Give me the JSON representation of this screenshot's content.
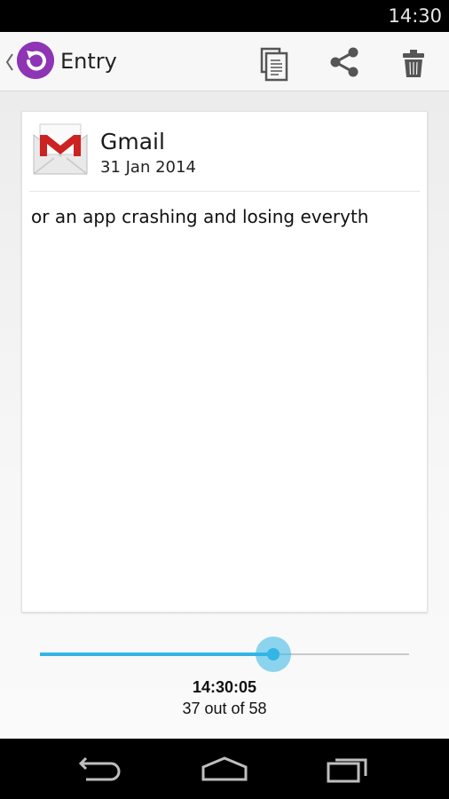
{
  "status_bar": {
    "time": "14:30"
  },
  "action_bar": {
    "title": "Entry",
    "icons": {
      "up": "chevron-left-icon",
      "app": "restore-icon",
      "copy": "copy-icon",
      "share": "share-icon",
      "delete": "trash-icon"
    }
  },
  "entry": {
    "app_name": "Gmail",
    "app_icon": "gmail-icon",
    "date": "31 Jan 2014",
    "text": "or an app crashing and losing everyth"
  },
  "history_slider": {
    "time": "14:30:05",
    "position_label": "37 out of 58",
    "current": 37,
    "total": 58
  },
  "nav_bar": {
    "icons": {
      "back": "back-icon",
      "home": "home-icon",
      "recents": "recents-icon"
    }
  },
  "colors": {
    "accent": "#33b5e5",
    "app_icon": "#8e34b5",
    "gmail_red": "#cc2222"
  }
}
